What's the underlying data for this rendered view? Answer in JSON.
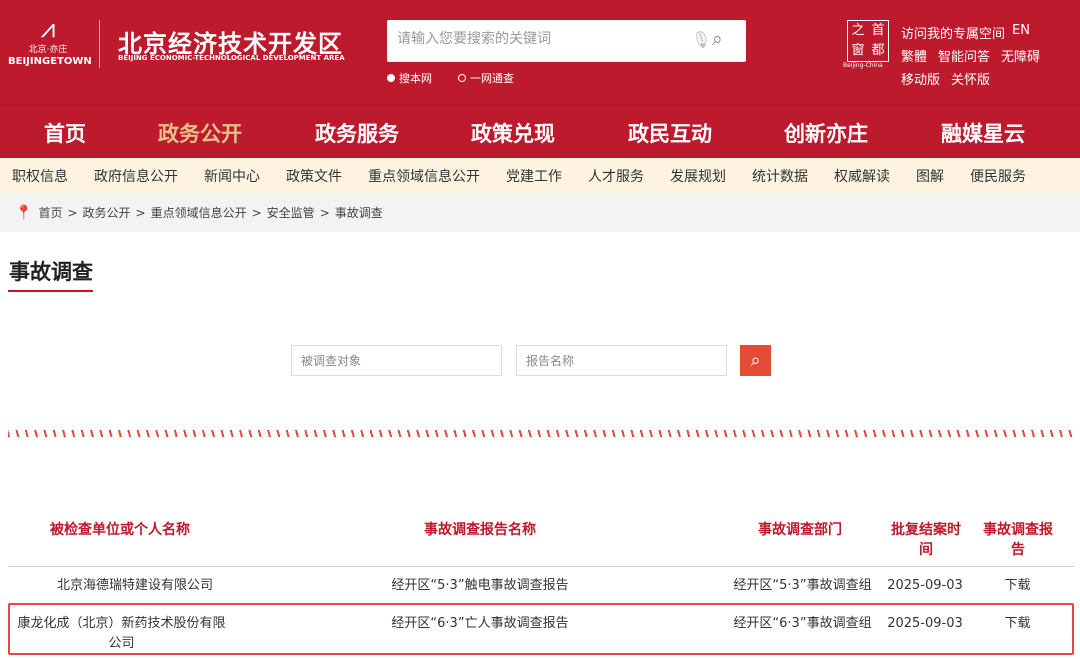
{
  "header": {
    "logo_cn": "北京·亦庄",
    "logo_en": "BEIJINGETOWN",
    "title": "北京经济技术开发区",
    "subtitle": "BEIJING ECONOMIC-TECHNOLOGICAL DEVELOPMENT AREA",
    "search_placeholder": "请输入您要搜索的关键词",
    "scope_options": [
      "搜本网",
      "一网通查"
    ],
    "emblem_chars": [
      "之",
      "首",
      "窗",
      "都"
    ],
    "emblem_caption": "Beijing-China",
    "links": [
      "访问我的专属空间",
      "EN",
      "繁體",
      "智能问答",
      "无障碍",
      "移动版",
      "关怀版"
    ]
  },
  "nav": {
    "items": [
      "首页",
      "政务公开",
      "政务服务",
      "政策兑现",
      "政民互动",
      "创新亦庄",
      "融媒星云"
    ],
    "active": "政务公开"
  },
  "subnav": {
    "items": [
      "职权信息",
      "政府信息公开",
      "新闻中心",
      "政策文件",
      "重点领域信息公开",
      "党建工作",
      "人才服务",
      "发展规划",
      "统计数据",
      "权威解读",
      "图解",
      "便民服务"
    ]
  },
  "breadcrumb": [
    "首页",
    "政务公开",
    "重点领域信息公开",
    "安全监管",
    "事故调查"
  ],
  "page_title": "事故调查",
  "filters": {
    "subject_placeholder": "被调查对象",
    "report_placeholder": "报告名称"
  },
  "table": {
    "headers": [
      "被检查单位或个人名称",
      "事故调查报告名称",
      "事故调查部门",
      "批复结案时间",
      "事故调查报告"
    ],
    "rows": [
      {
        "unit": "北京海德瑞特建设有限公司",
        "report": "经开区“5·3”触电事故调查报告",
        "dept": "经开区“5·3”事故调查组",
        "date": "2025-09-03",
        "download": "下载"
      },
      {
        "unit": "康龙化成（北京）新药技术股份有限公司",
        "report": "经开区“6·3”亡人事故调查报告",
        "dept": "经开区“6·3”事故调查组",
        "date": "2025-09-03",
        "download": "下载"
      }
    ]
  },
  "colors": {
    "brand_red": "#bd1a2d",
    "gold": "#e5c28a",
    "highlight": "#e6454a"
  }
}
